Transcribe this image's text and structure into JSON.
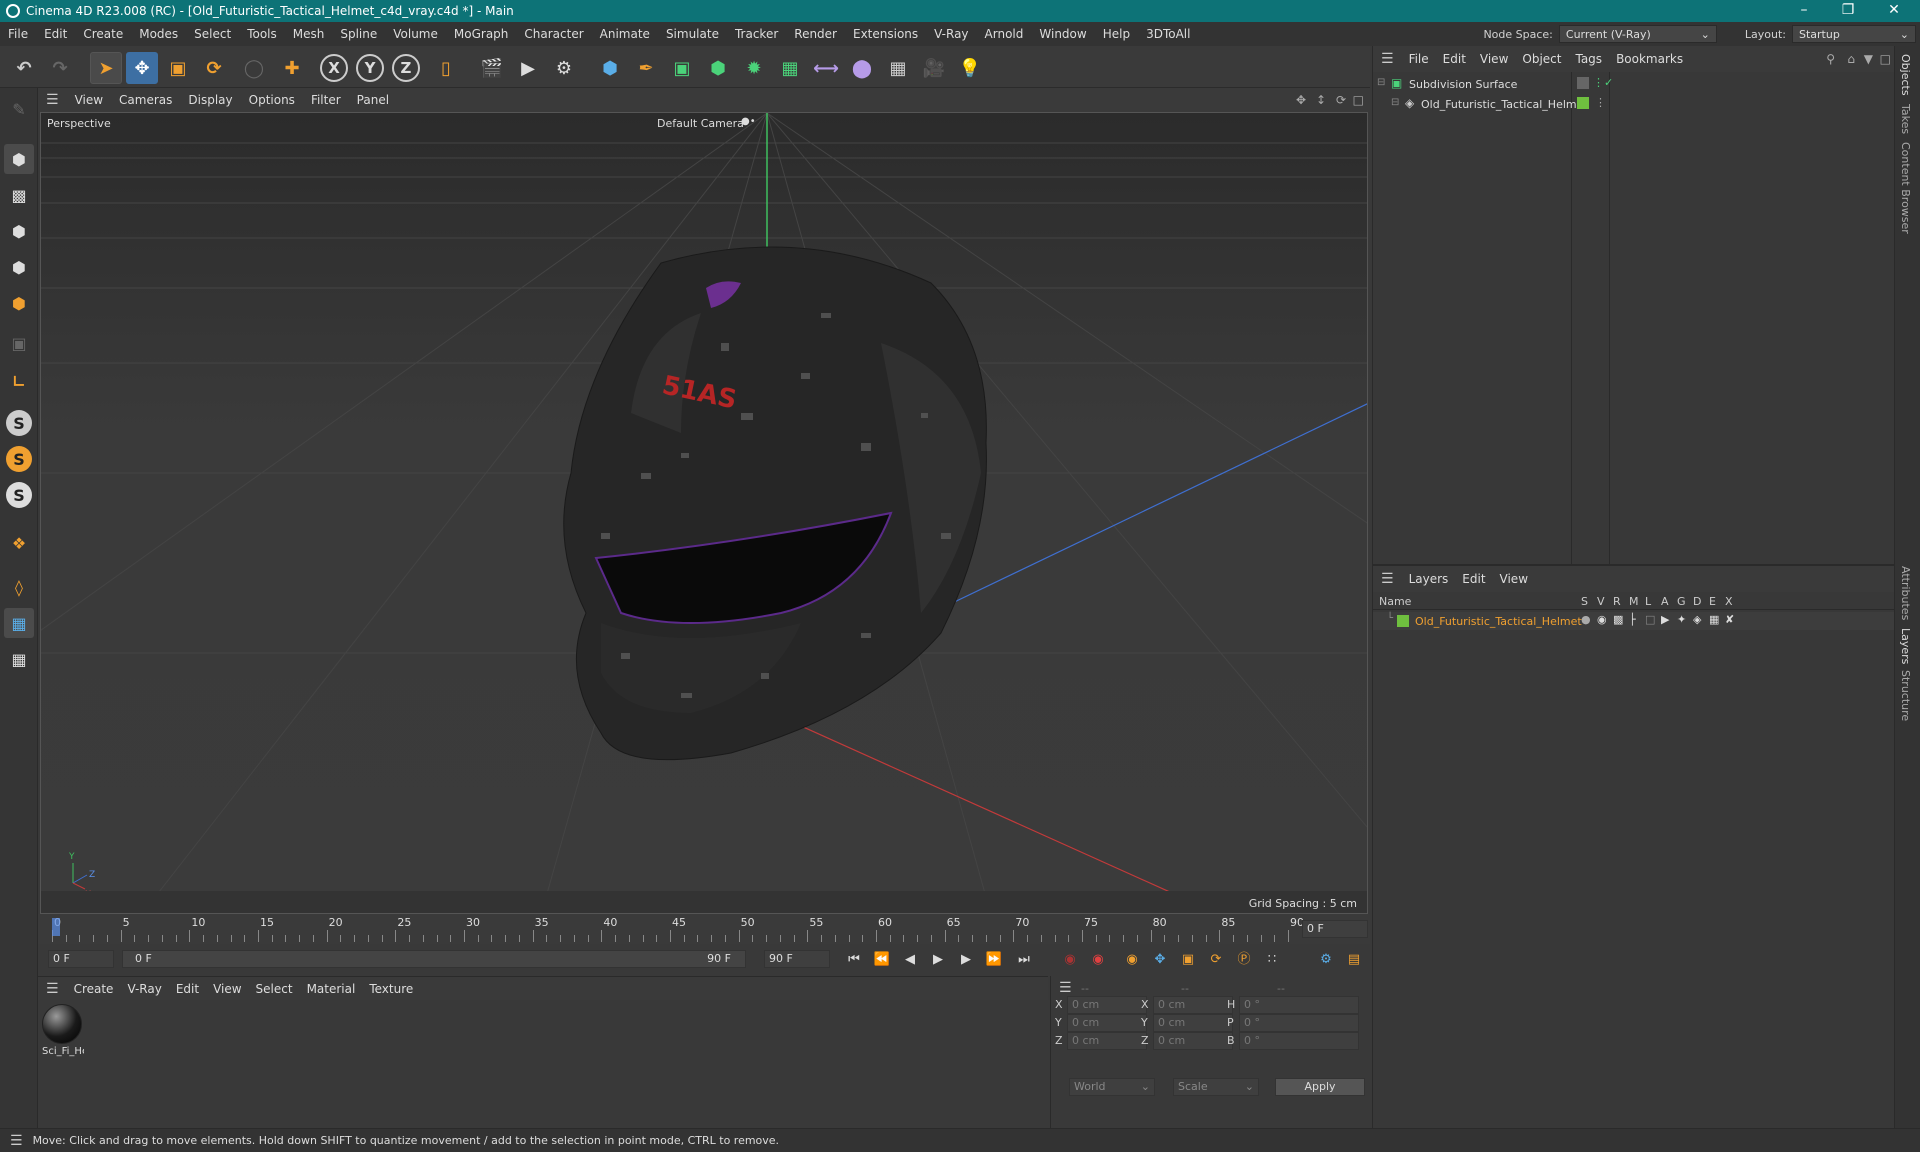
{
  "app": {
    "title": "Cinema 4D R23.008 (RC) - [Old_Futuristic_Tactical_Helmet_c4d_vray.c4d *] - Main",
    "accent": "#0d7377"
  },
  "menubar": {
    "items": [
      "File",
      "Edit",
      "Create",
      "Modes",
      "Select",
      "Tools",
      "Mesh",
      "Spline",
      "Volume",
      "MoGraph",
      "Character",
      "Animate",
      "Simulate",
      "Tracker",
      "Render",
      "Extensions",
      "V-Ray",
      "Arnold",
      "Window",
      "Help",
      "3DToAll"
    ],
    "node_space_label": "Node Space:",
    "node_space_value": "Current (V-Ray)",
    "layout_label": "Layout:",
    "layout_value": "Startup"
  },
  "viewport": {
    "menu": [
      "View",
      "Cameras",
      "Display",
      "Options",
      "Filter",
      "Panel"
    ],
    "view_name": "Perspective",
    "camera": "Default Camera",
    "grid_spacing": "Grid Spacing : 5 cm"
  },
  "timeline": {
    "ticks": [
      "0",
      "5",
      "10",
      "15",
      "20",
      "25",
      "30",
      "35",
      "40",
      "45",
      "50",
      "55",
      "60",
      "65",
      "70",
      "75",
      "80",
      "85",
      "90"
    ],
    "current_frame": "0 F"
  },
  "playbar": {
    "start": "0 F",
    "range_start": "0 F",
    "range_end": "90 F",
    "end": "90 F"
  },
  "material": {
    "menu": [
      "Create",
      "V-Ray",
      "Edit",
      "View",
      "Select",
      "Material",
      "Texture"
    ],
    "items": [
      {
        "name": "Sci_Fi_He"
      }
    ]
  },
  "coords": {
    "headers": [
      "--",
      "--",
      "--"
    ],
    "rows": [
      {
        "a": "X",
        "av": "0 cm",
        "b": "X",
        "bv": "0 cm",
        "c": "H",
        "cv": "0 °"
      },
      {
        "a": "Y",
        "av": "0 cm",
        "b": "Y",
        "bv": "0 cm",
        "c": "P",
        "cv": "0 °"
      },
      {
        "a": "Z",
        "av": "0 cm",
        "b": "Z",
        "bv": "0 cm",
        "c": "B",
        "cv": "0 °"
      }
    ],
    "world": "World",
    "scale": "Scale",
    "apply": "Apply"
  },
  "objects": {
    "menu": [
      "File",
      "Edit",
      "View",
      "Object",
      "Tags",
      "Bookmarks"
    ],
    "items": [
      {
        "name": "Subdivision Surface"
      },
      {
        "name": "Old_Futuristic_Tactical_Helmet"
      }
    ]
  },
  "layers": {
    "menu": [
      "Layers",
      "Edit",
      "View"
    ],
    "col_name": "Name",
    "cols": [
      "S",
      "V",
      "R",
      "M",
      "L",
      "A",
      "G",
      "D",
      "E",
      "X"
    ],
    "items": [
      {
        "name": "Old_Futuristic_Tactical_Helmet",
        "color": "#6fbf3f"
      }
    ]
  },
  "sidetabs": [
    "Objects",
    "Takes",
    "Content Browser",
    "Attributes",
    "Layers",
    "Structure"
  ],
  "status": {
    "text": "Move: Click and drag to move elements. Hold down SHIFT to quantize movement / add to the selection in point mode, CTRL to remove."
  }
}
